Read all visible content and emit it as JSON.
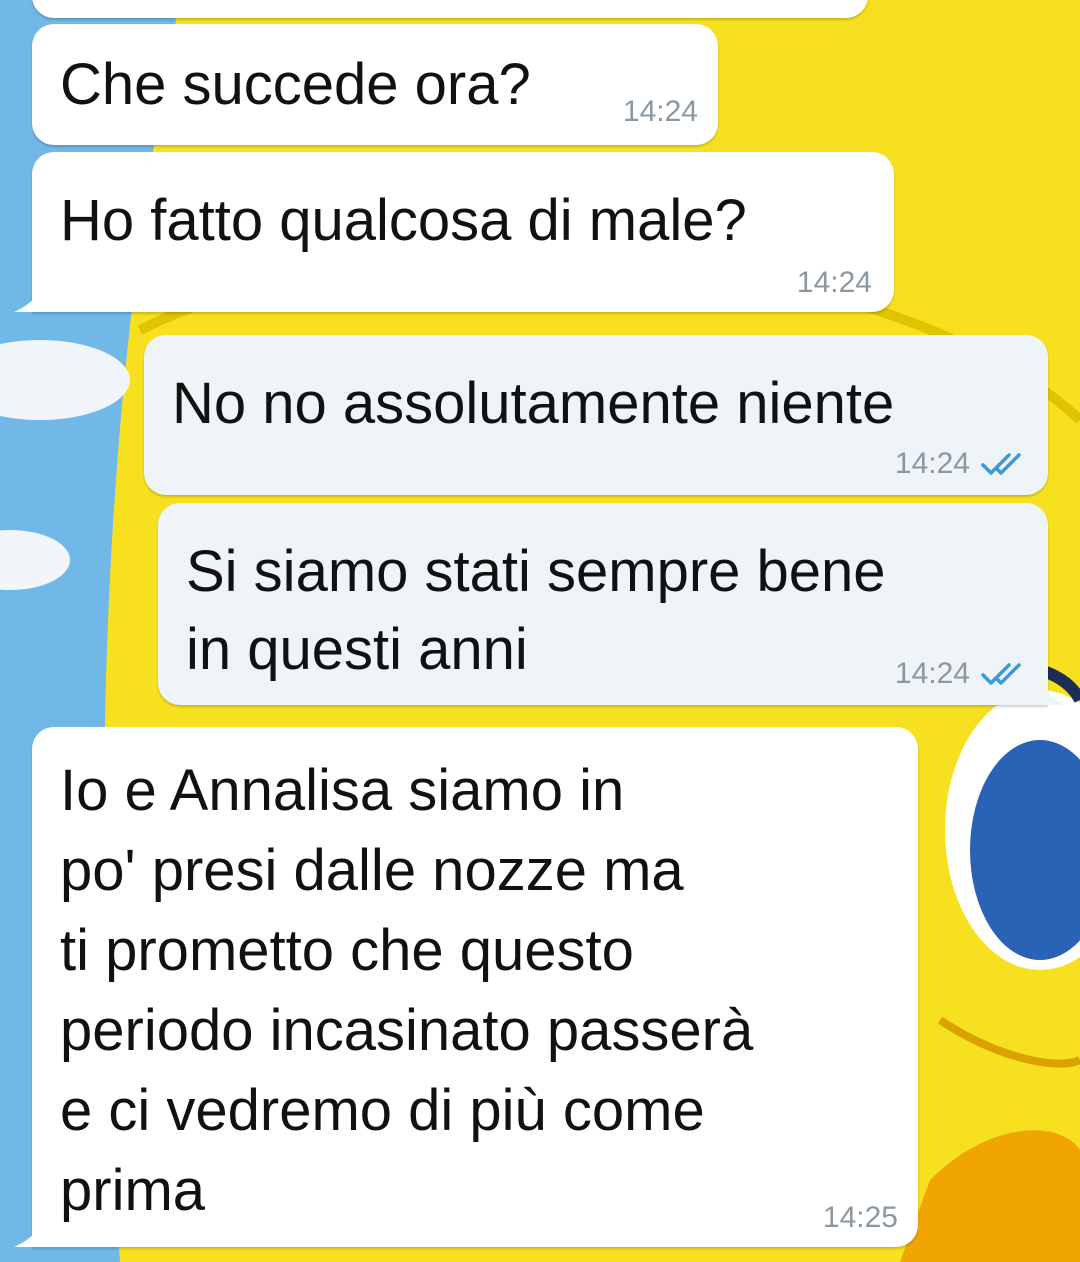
{
  "messages": [
    {
      "id": "m1",
      "direction": "incoming",
      "text": "Che succede ora?",
      "time": "14:24"
    },
    {
      "id": "m2",
      "direction": "incoming",
      "text": "Ho fatto qualcosa di male?",
      "time": "14:24"
    },
    {
      "id": "m3",
      "direction": "outgoing",
      "text": "No no assolutamente niente",
      "time": "14:24",
      "status": "read"
    },
    {
      "id": "m4",
      "direction": "outgoing",
      "text": "Si siamo stati sempre bene\nin questi anni",
      "time": "14:24",
      "status": "read"
    },
    {
      "id": "m5",
      "direction": "incoming",
      "text": "Io e Annalisa siamo in\npo' presi dalle nozze ma\nti prometto che questo\nperiodo incasinato passerà\ne ci vedremo di più come\nprima",
      "time": "14:25"
    }
  ],
  "colors": {
    "wallpaper_yellow": "#f7e020",
    "wallpaper_sky": "#6fb8e8",
    "incoming_bubble": "#ffffff",
    "outgoing_bubble": "#eef4f8",
    "read_check": "#3a9bd8",
    "timestamp": "#8a98a2"
  },
  "icons": {
    "read_receipt": "double-check-icon"
  }
}
